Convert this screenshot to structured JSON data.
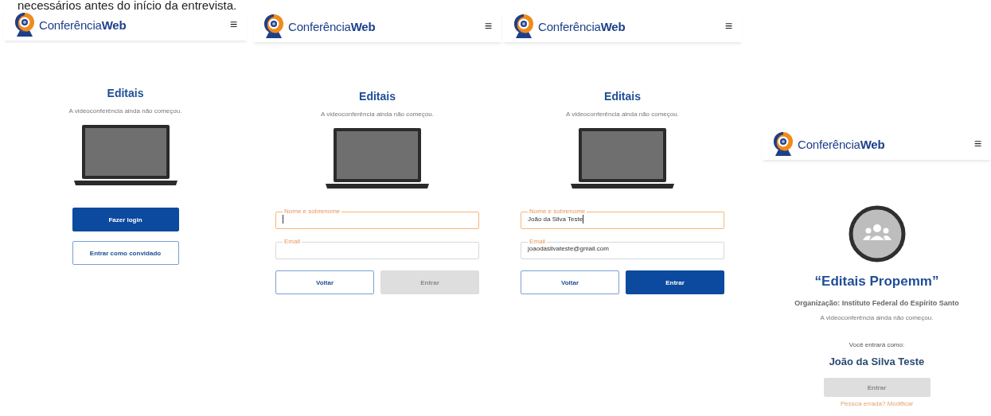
{
  "caption": "necessários antes do início da entrevista.",
  "screens": [
    {
      "kind": "start",
      "brand": "Conferência**Web**",
      "menu": "≡",
      "title": "Editais",
      "status": "A videoconferência ainda não começou.",
      "buttons": [
        {
          "label": "Fazer login",
          "kind": "primary",
          "disabled": false
        },
        {
          "label": "Entrar como convidado",
          "kind": "outline",
          "disabled": false
        }
      ]
    },
    {
      "kind": "form",
      "brand": "Conferência**Web**",
      "menu": "≡",
      "title": "Editais",
      "status": "A videoconferência ainda não começou.",
      "fields": [
        {
          "label": "Nome e sobrenome",
          "focused": true
        },
        {
          "label": "Email",
          "focused": false
        }
      ],
      "buttons": [
        {
          "label": "Voltar",
          "kind": "outline",
          "disabled": false
        },
        {
          "label": "Entrar",
          "kind": "primary",
          "disabled": true
        }
      ]
    },
    {
      "kind": "form",
      "brand": "Conferência**Web**",
      "menu": "≡",
      "title": "Editais",
      "status": "A videoconferência ainda não começou.",
      "fields": [
        {
          "label": "Nome e sobrenome",
          "value": "João da Silva Teste",
          "focused": true
        },
        {
          "label": "Email",
          "value": "joaodasilvateste@gmail.com",
          "focused": false
        }
      ],
      "buttons": [
        {
          "label": "Voltar",
          "kind": "outline",
          "disabled": false
        },
        {
          "label": "Entrar",
          "kind": "primary",
          "disabled": false
        }
      ]
    },
    {
      "kind": "confirm",
      "brand": "Conferência**Web**",
      "menu": "≡",
      "title": "“Editais Propemm”",
      "organization": "Organização: Instituto Federal do Espírito Santo",
      "status": "A videoconferência ainda não começou.",
      "join_label": "Você entrará como:",
      "participant": "João da Silva Teste",
      "buttons": [
        {
          "label": "Entrar",
          "kind": "primary",
          "disabled": true
        }
      ],
      "link": "Pessoa errada? Modificar"
    }
  ]
}
